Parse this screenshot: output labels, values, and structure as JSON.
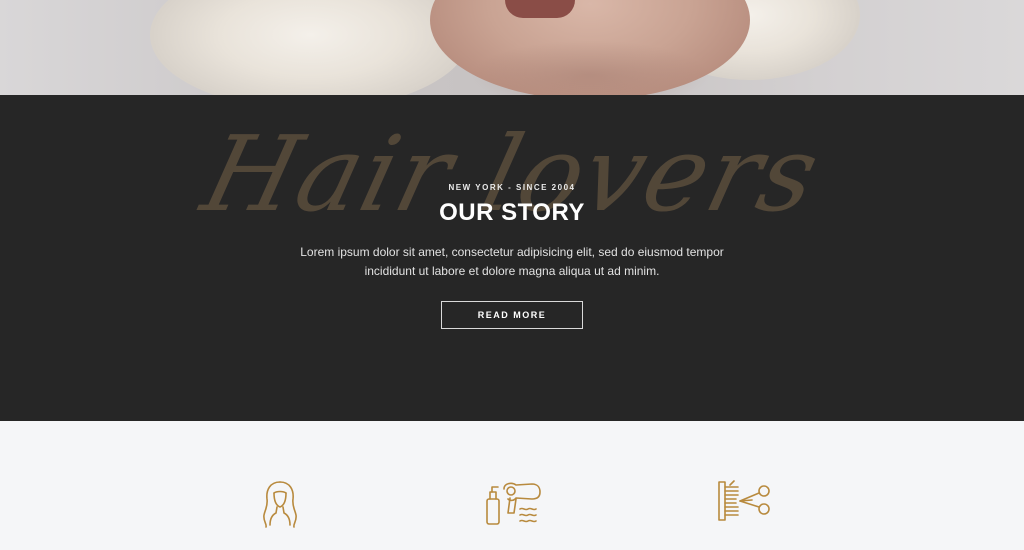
{
  "story": {
    "script_word": "Hair lovers",
    "eyebrow": "NEW YORK - SINCE 2004",
    "title": "OUR STORY",
    "body_line1": "Lorem ipsum dolor sit amet, consectetur adipisicing elit, sed do eiusmod tempor",
    "body_line2": "incididunt ut labore et dolore magna aliqua ut ad minim.",
    "button_label": "READ MORE"
  },
  "services": {
    "icons": [
      "woman-hair-icon",
      "hair-dryer-icon",
      "comb-scissors-icon"
    ]
  },
  "colors": {
    "dark_bg": "#262626",
    "light_bg": "#f5f6f8",
    "accent_gold": "#b88a3e",
    "script_brown": "#5a4d3c"
  }
}
